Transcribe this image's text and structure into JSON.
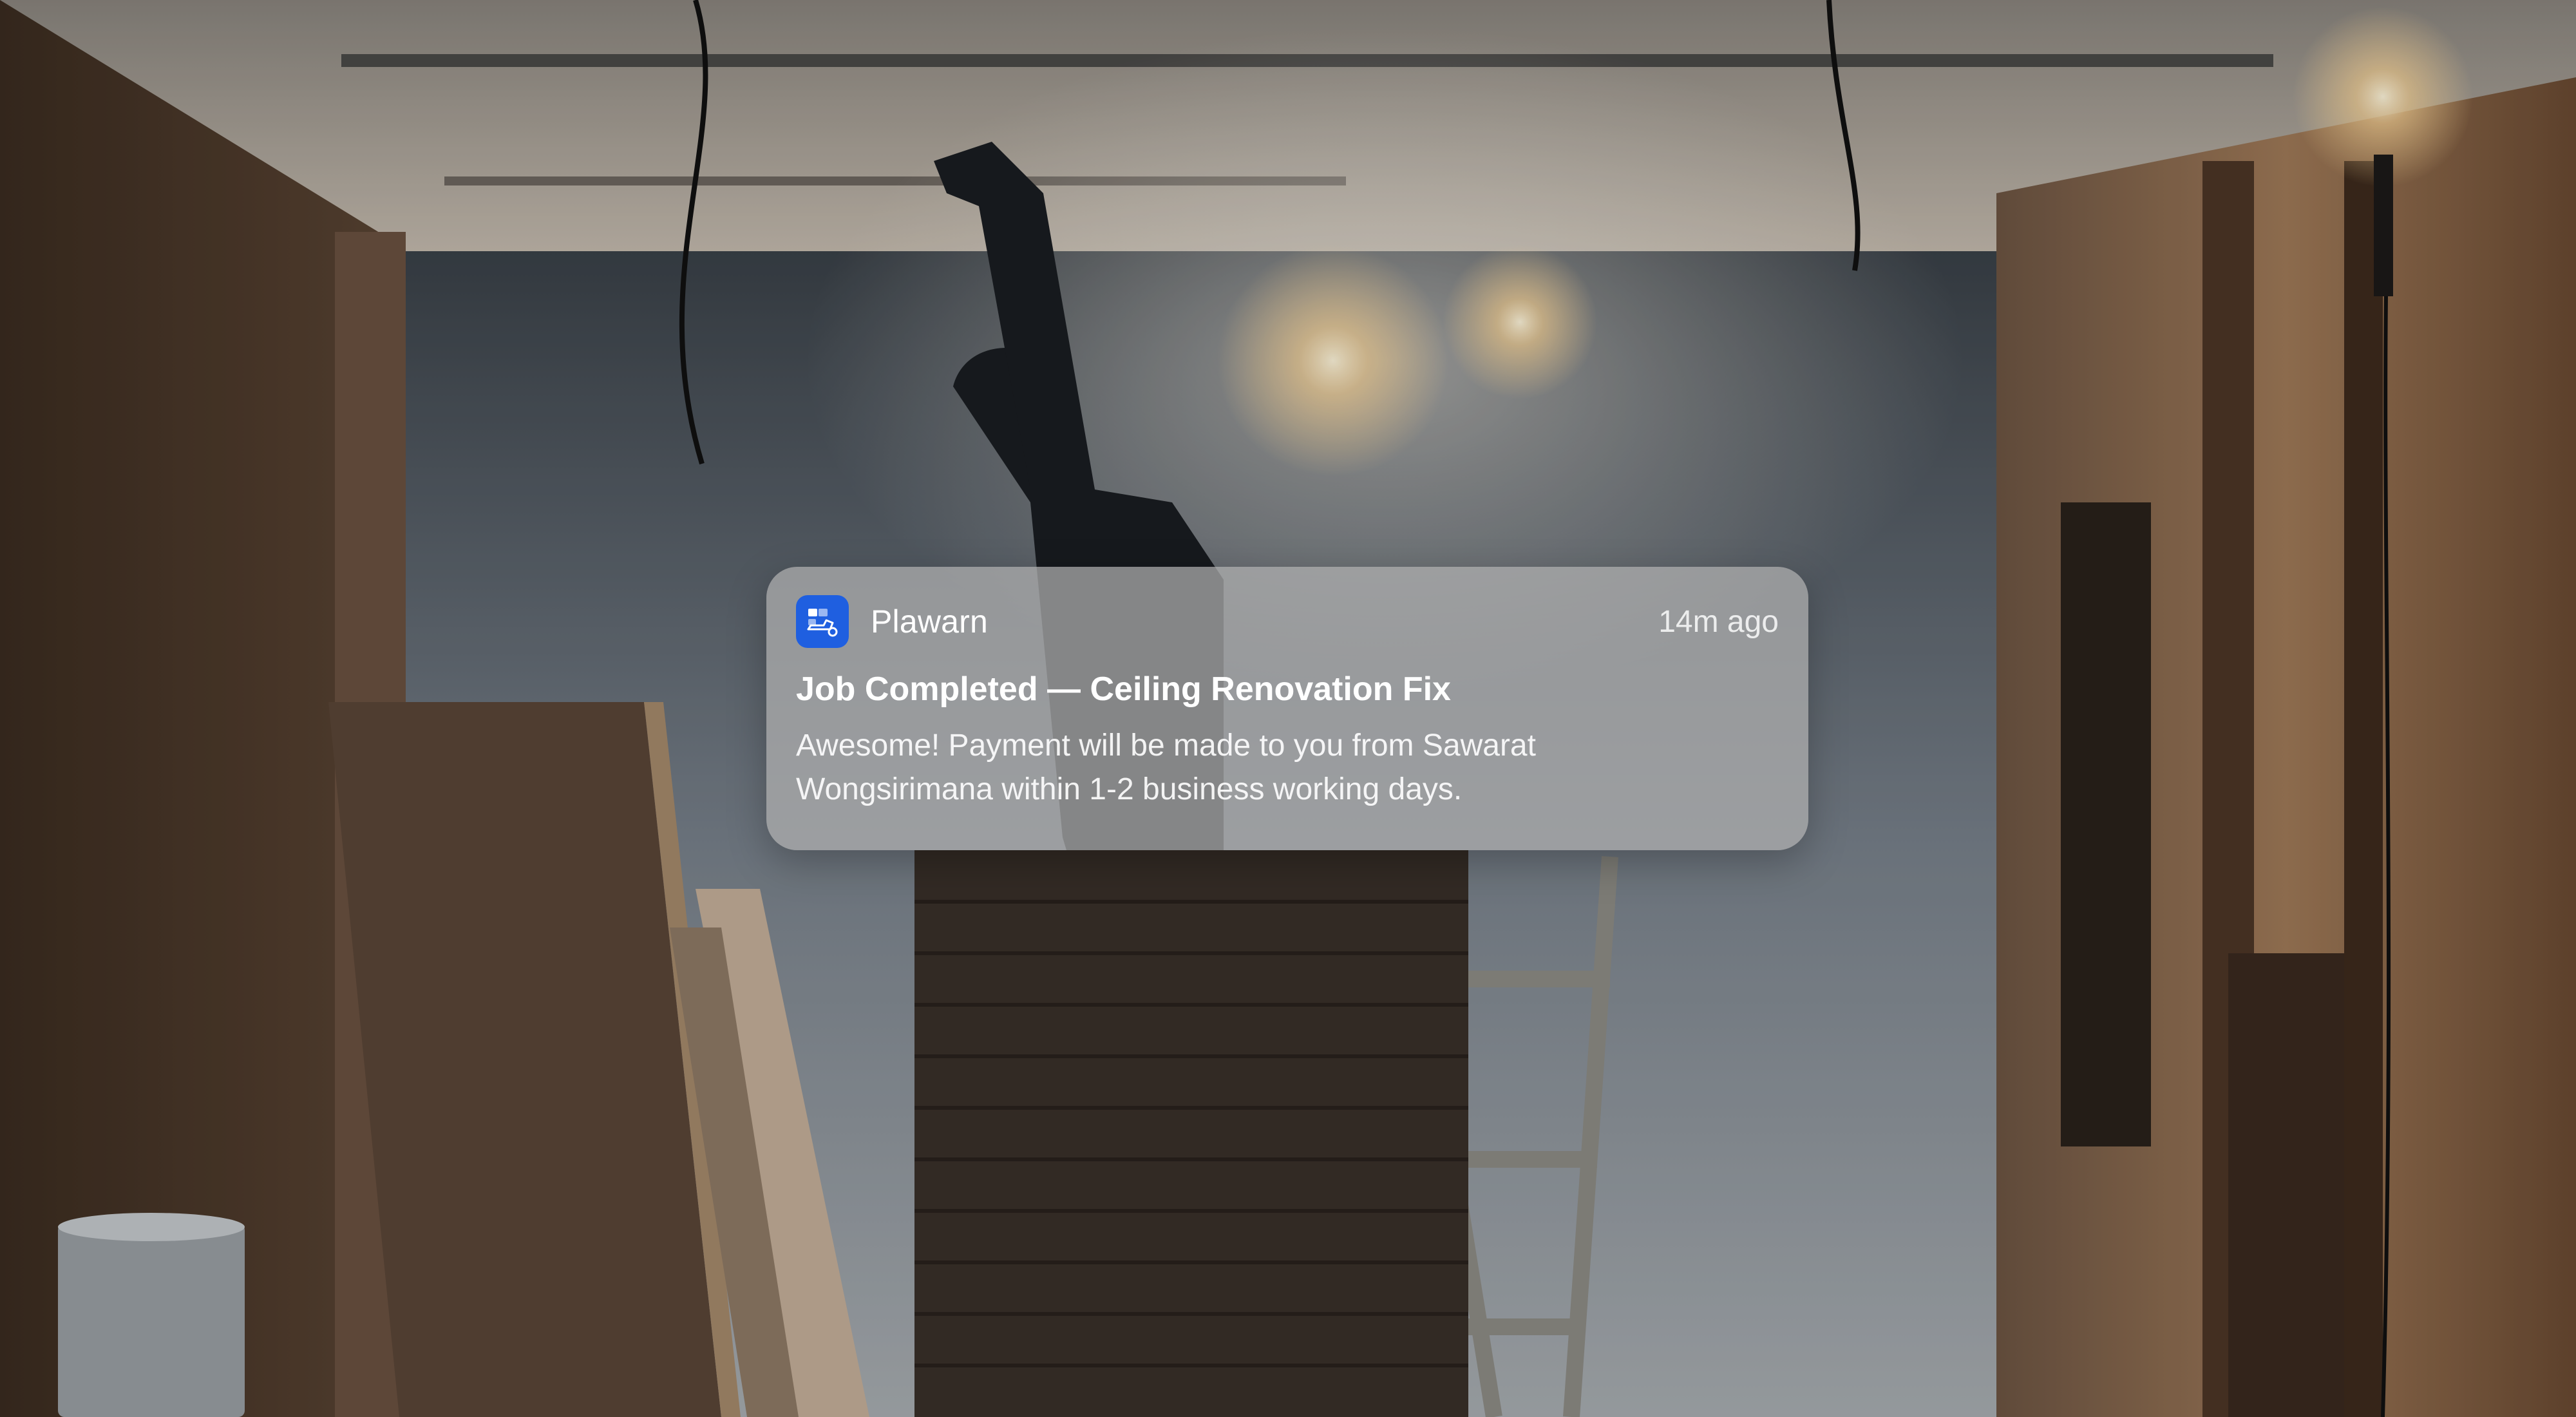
{
  "notification": {
    "app_name": "Plawarn",
    "app_icon": "plawarn-app-icon",
    "app_icon_color": "#1f5fe0",
    "timestamp": "14m ago",
    "title": "Job Completed — Ceiling Renovation Fix",
    "body": "Awesome! Payment will be made to you from Sawarat Wongsirimana within 1-2 business working days."
  },
  "background": {
    "icon": "construction-photo"
  }
}
